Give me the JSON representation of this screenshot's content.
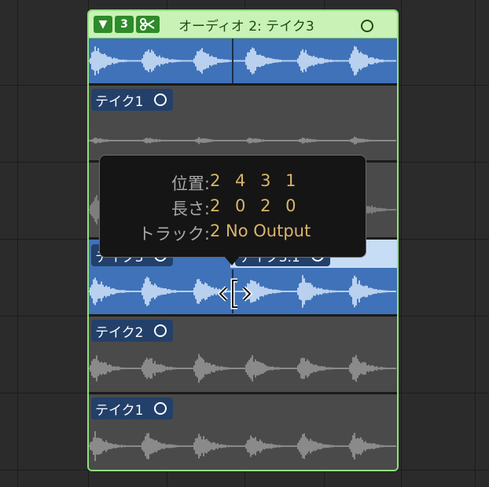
{
  "folder": {
    "take_count": "3",
    "title": "オーディオ 2: テイク3",
    "colors": {
      "border": "#8fe07c",
      "header": "#c9f2b6",
      "selected": "#3f72b8",
      "unselected": "#4a4a4a"
    }
  },
  "lanes": [
    {
      "label": "テイク1"
    },
    {
      "label": "テイク3",
      "split_label": "テイク3.1"
    },
    {
      "label": "テイク2"
    },
    {
      "label": "テイク1"
    }
  ],
  "tooltip": {
    "position_label": "位置:",
    "position_value": "2 4 3 1",
    "length_label": "長さ:",
    "length_value": "2 0 2 0",
    "track_label": "トラック:",
    "track_value": "2  No Output"
  }
}
